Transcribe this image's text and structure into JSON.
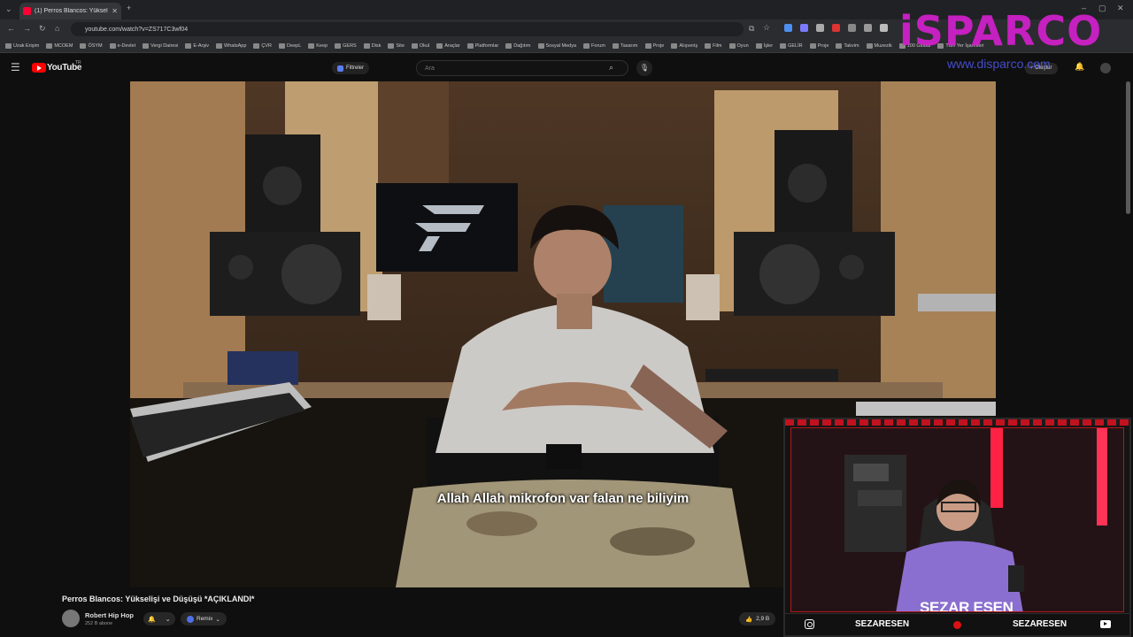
{
  "browser": {
    "tab_title": "(1) Perros Blancos: Yükselişi",
    "url": "youtube.com/watch?v=ZS717C3wf04"
  },
  "bookmarks": [
    "Uzak Erişim",
    "MCOEM",
    "ÖSYM",
    "e-Devlet",
    "Vergi Dairesi",
    "E-Arşiv",
    "WhatsApp",
    "ÇVR",
    "DeepL",
    "Keep",
    "GERS",
    "Disk",
    "Site",
    "Okul",
    "Araçlar",
    "Platformlar",
    "Dağıtım",
    "Sosyal Medya",
    "Forum",
    "Tasarım",
    "Proje",
    "Alışveriş",
    "Film",
    "Oyun",
    "İşler",
    "GELİR",
    "Proje",
    "Takvim",
    "Muzezik",
    "100 Global",
    "Tüm Yer İşaretleri"
  ],
  "youtube": {
    "logo_text": "YouTube",
    "region": "TR",
    "filters_label": "Filtreler",
    "search_placeholder": "Ara",
    "create_label": "+ Oluştur"
  },
  "watermark": {
    "brand": "iSPARCO",
    "url": "www.disparco.com"
  },
  "video": {
    "subtitle": "Allah Allah mikrofon var falan ne biliyim",
    "title": "Perros Blancos: Yükselişi ve Düşüşü *AÇIKLANDI*",
    "channel_name": "Robert Hip Hop",
    "subscribers": "252 B abone",
    "remix_label": "Remix",
    "likes": "2,9 B"
  },
  "webcam": {
    "name": "SEZAR ESEN",
    "handle_left": "SEZARESEN",
    "handle_right": "SEZARESEN"
  },
  "colors": {
    "youtube_red": "#ff0000",
    "overlay_red": "#c1121f",
    "watermark_magenta": "#d61fd0"
  },
  "icons": [
    "menu-icon",
    "search-icon",
    "mic-icon",
    "bell-icon",
    "instagram-icon",
    "youtube-icon",
    "like-icon"
  ]
}
